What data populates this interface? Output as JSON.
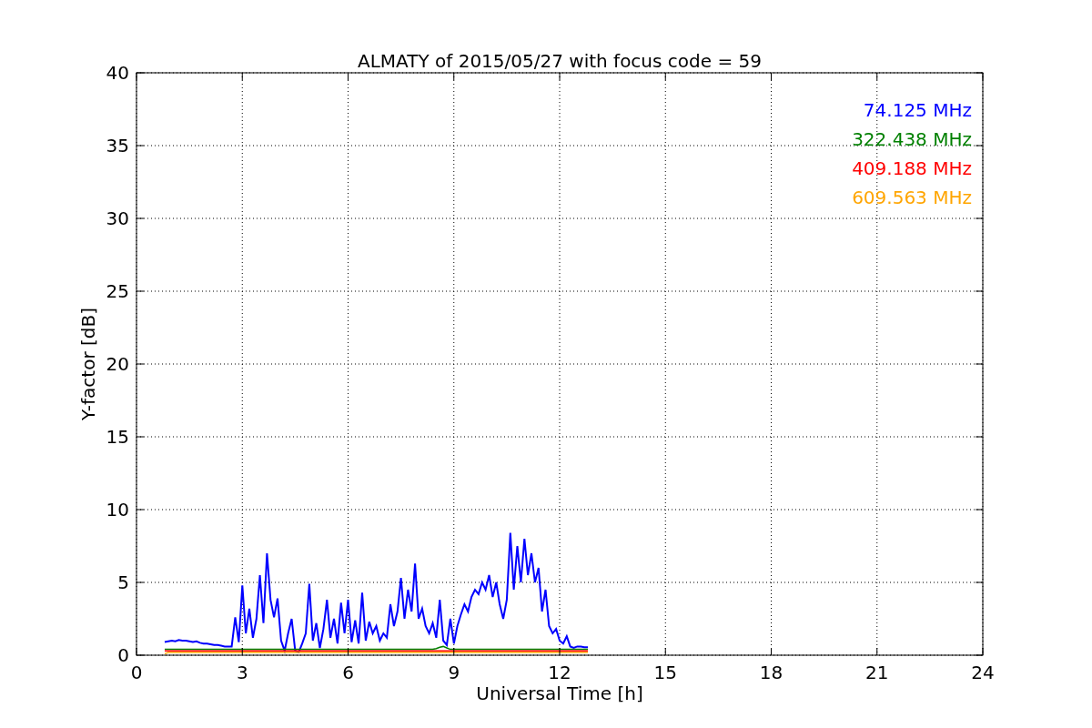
{
  "chart_data": {
    "type": "line",
    "title": "ALMATY of 2015/05/27 with focus code = 59",
    "xlabel": "Universal Time [h]",
    "ylabel": "Y-factor [dB]",
    "xlim": [
      0,
      24
    ],
    "ylim": [
      0,
      40
    ],
    "xticks": [
      0,
      3,
      6,
      9,
      12,
      15,
      18,
      21,
      24
    ],
    "yticks": [
      0,
      5,
      10,
      15,
      20,
      25,
      30,
      35,
      40
    ],
    "grid": true,
    "x": [
      0.8,
      0.9,
      1.0,
      1.1,
      1.2,
      1.3,
      1.4,
      1.5,
      1.6,
      1.7,
      1.8,
      1.9,
      2.0,
      2.1,
      2.2,
      2.3,
      2.4,
      2.5,
      2.6,
      2.7,
      2.8,
      2.9,
      3.0,
      3.1,
      3.2,
      3.3,
      3.4,
      3.5,
      3.6,
      3.7,
      3.8,
      3.9,
      4.0,
      4.1,
      4.2,
      4.3,
      4.4,
      4.5,
      4.6,
      4.7,
      4.8,
      4.9,
      5.0,
      5.1,
      5.2,
      5.3,
      5.4,
      5.5,
      5.6,
      5.7,
      5.8,
      5.9,
      6.0,
      6.1,
      6.2,
      6.3,
      6.4,
      6.5,
      6.6,
      6.7,
      6.8,
      6.9,
      7.0,
      7.1,
      7.2,
      7.3,
      7.4,
      7.5,
      7.6,
      7.7,
      7.8,
      7.9,
      8.0,
      8.1,
      8.2,
      8.3,
      8.4,
      8.5,
      8.6,
      8.7,
      8.8,
      8.9,
      9.0,
      9.1,
      9.2,
      9.3,
      9.4,
      9.5,
      9.6,
      9.7,
      9.8,
      9.9,
      10.0,
      10.1,
      10.2,
      10.3,
      10.4,
      10.5,
      10.6,
      10.7,
      10.8,
      10.9,
      11.0,
      11.1,
      11.2,
      11.3,
      11.4,
      11.5,
      11.6,
      11.7,
      11.8,
      11.9,
      12.0,
      12.1,
      12.2,
      12.3,
      12.4,
      12.5,
      12.6,
      12.7,
      12.8
    ],
    "series": [
      {
        "name": "74.125 MHz",
        "color": "#0000ff",
        "values": [
          0.9,
          0.95,
          1.0,
          0.95,
          1.05,
          1.0,
          1.0,
          0.95,
          0.9,
          0.95,
          0.85,
          0.8,
          0.8,
          0.75,
          0.7,
          0.7,
          0.65,
          0.6,
          0.6,
          0.6,
          2.6,
          0.9,
          4.8,
          1.5,
          3.2,
          1.2,
          2.5,
          5.5,
          2.2,
          7.0,
          3.8,
          2.6,
          3.9,
          1.0,
          0.3,
          1.5,
          2.5,
          0.3,
          0.2,
          0.8,
          1.5,
          4.9,
          1.0,
          2.2,
          0.5,
          1.8,
          3.8,
          1.2,
          2.5,
          0.8,
          3.6,
          1.5,
          3.8,
          0.9,
          2.4,
          0.8,
          4.3,
          1.0,
          2.3,
          1.5,
          2.0,
          1.0,
          1.5,
          1.2,
          3.5,
          2.0,
          3.0,
          5.3,
          2.5,
          4.5,
          3.0,
          6.3,
          2.5,
          3.2,
          2.0,
          1.5,
          2.2,
          1.2,
          3.8,
          1.0,
          0.7,
          2.5,
          0.8,
          2.0,
          2.8,
          3.5,
          3.0,
          4.0,
          4.5,
          4.2,
          5.0,
          4.5,
          5.5,
          4.0,
          5.0,
          3.5,
          2.5,
          3.8,
          8.4,
          4.5,
          7.5,
          5.0,
          8.0,
          5.5,
          7.0,
          5.0,
          6.0,
          3.0,
          4.5,
          2.0,
          1.5,
          1.8,
          1.0,
          0.8,
          1.3,
          0.6,
          0.5,
          0.6,
          0.6,
          0.55,
          0.55
        ]
      },
      {
        "name": "322.438 MHz",
        "color": "#008000",
        "values": [
          0.4,
          0.4,
          0.4,
          0.4,
          0.4,
          0.4,
          0.4,
          0.4,
          0.4,
          0.4,
          0.4,
          0.4,
          0.4,
          0.4,
          0.4,
          0.4,
          0.4,
          0.4,
          0.4,
          0.4,
          0.4,
          0.4,
          0.4,
          0.4,
          0.4,
          0.4,
          0.4,
          0.4,
          0.4,
          0.4,
          0.4,
          0.4,
          0.4,
          0.4,
          0.4,
          0.4,
          0.4,
          0.4,
          0.4,
          0.4,
          0.4,
          0.4,
          0.4,
          0.4,
          0.4,
          0.4,
          0.4,
          0.4,
          0.4,
          0.4,
          0.4,
          0.4,
          0.4,
          0.4,
          0.4,
          0.4,
          0.4,
          0.4,
          0.4,
          0.4,
          0.4,
          0.4,
          0.4,
          0.4,
          0.4,
          0.4,
          0.4,
          0.4,
          0.4,
          0.4,
          0.4,
          0.4,
          0.4,
          0.4,
          0.4,
          0.4,
          0.4,
          0.45,
          0.55,
          0.6,
          0.5,
          0.4,
          0.4,
          0.4,
          0.4,
          0.4,
          0.4,
          0.4,
          0.4,
          0.4,
          0.4,
          0.4,
          0.4,
          0.4,
          0.4,
          0.4,
          0.4,
          0.4,
          0.4,
          0.4,
          0.4,
          0.4,
          0.4,
          0.4,
          0.4,
          0.4,
          0.4,
          0.4,
          0.4,
          0.4,
          0.4,
          0.4,
          0.4,
          0.4,
          0.4,
          0.4,
          0.4,
          0.4,
          0.4,
          0.4,
          0.4
        ]
      },
      {
        "name": "409.188 MHz",
        "color": "#ff0000",
        "values": [
          0.3,
          0.3,
          0.3,
          0.3,
          0.3,
          0.3,
          0.3,
          0.3,
          0.3,
          0.3,
          0.3,
          0.3,
          0.3,
          0.3,
          0.3,
          0.3,
          0.3,
          0.3,
          0.3,
          0.3,
          0.3,
          0.3,
          0.3,
          0.3,
          0.3,
          0.3,
          0.3,
          0.3,
          0.3,
          0.3,
          0.3,
          0.3,
          0.3,
          0.3,
          0.3,
          0.3,
          0.3,
          0.3,
          0.3,
          0.3,
          0.3,
          0.3,
          0.3,
          0.3,
          0.3,
          0.3,
          0.3,
          0.3,
          0.3,
          0.3,
          0.3,
          0.3,
          0.3,
          0.3,
          0.3,
          0.3,
          0.3,
          0.3,
          0.3,
          0.3,
          0.3,
          0.3,
          0.3,
          0.3,
          0.3,
          0.3,
          0.3,
          0.3,
          0.3,
          0.3,
          0.3,
          0.3,
          0.3,
          0.3,
          0.3,
          0.3,
          0.3,
          0.3,
          0.3,
          0.3,
          0.3,
          0.3,
          0.3,
          0.3,
          0.3,
          0.3,
          0.3,
          0.3,
          0.3,
          0.3,
          0.3,
          0.3,
          0.3,
          0.3,
          0.3,
          0.3,
          0.3,
          0.3,
          0.3,
          0.3,
          0.3,
          0.3,
          0.3,
          0.3,
          0.3,
          0.3,
          0.3,
          0.3,
          0.3,
          0.3,
          0.3,
          0.3,
          0.3,
          0.3,
          0.3,
          0.3,
          0.3,
          0.3,
          0.3,
          0.3,
          0.3
        ]
      },
      {
        "name": "609.563 MHz",
        "color": "#ffa500",
        "values": [
          0.1,
          0.18,
          0.18,
          0.18,
          0.18,
          0.18,
          0.18,
          0.18,
          0.18,
          0.18,
          0.18,
          0.18,
          0.18,
          0.18,
          0.18,
          0.18,
          0.18,
          0.18,
          0.18,
          0.18,
          0.18,
          0.18,
          0.18,
          0.18,
          0.18,
          0.18,
          0.18,
          0.18,
          0.18,
          0.18,
          0.18,
          0.18,
          0.18,
          0.18,
          0.18,
          0.18,
          0.18,
          0.18,
          0.18,
          0.18,
          0.18,
          0.18,
          0.18,
          0.18,
          0.18,
          0.18,
          0.18,
          0.18,
          0.18,
          0.18,
          0.18,
          0.18,
          0.18,
          0.18,
          0.18,
          0.18,
          0.18,
          0.18,
          0.18,
          0.18,
          0.18,
          0.18,
          0.18,
          0.18,
          0.18,
          0.18,
          0.18,
          0.18,
          0.18,
          0.18,
          0.18,
          0.18,
          0.18,
          0.18,
          0.18,
          0.18,
          0.18,
          0.18,
          0.18,
          0.18,
          0.18,
          0.18,
          0.18,
          0.18,
          0.18,
          0.18,
          0.18,
          0.18,
          0.18,
          0.18,
          0.18,
          0.18,
          0.18,
          0.18,
          0.18,
          0.18,
          0.18,
          0.18,
          0.18,
          0.18,
          0.18,
          0.18,
          0.18,
          0.18,
          0.18,
          0.18,
          0.18,
          0.18,
          0.18,
          0.18,
          0.18,
          0.18,
          0.18,
          0.18,
          0.18,
          0.18,
          0.18,
          0.18,
          0.18,
          0.18,
          0.18
        ]
      }
    ]
  }
}
